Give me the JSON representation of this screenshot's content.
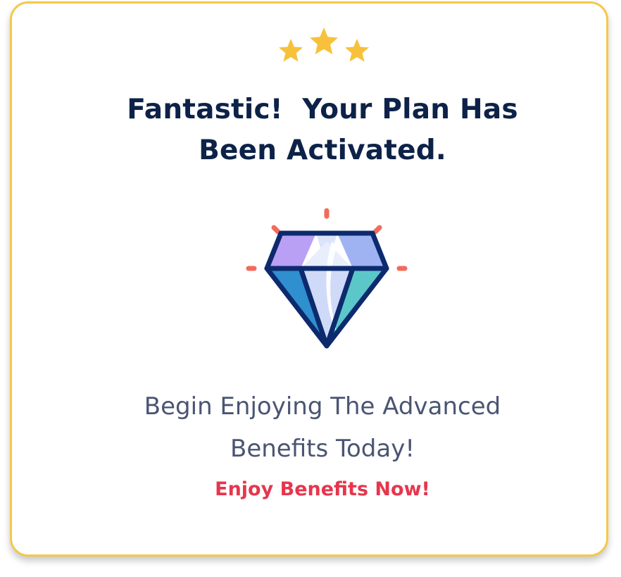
{
  "card": {
    "title_lines": [
      "Fantastic!  Your Plan Has",
      "Been Activated."
    ],
    "subtitle_lines": [
      "Begin Enjoying The Advanced",
      "Benefits Today!"
    ],
    "cta_label": "Enjoy Benefits Now!"
  },
  "icons": {
    "stars": "three-stars-icon",
    "diamond": "diamond-icon"
  },
  "colors": {
    "card_border": "#f4c84a",
    "star": "#f7c13b",
    "title": "#0d2248",
    "subtitle": "#4a5573",
    "cta": "#e5364d",
    "diamond_outline": "#0d2a6e",
    "sparkle": "#f26b5b"
  }
}
